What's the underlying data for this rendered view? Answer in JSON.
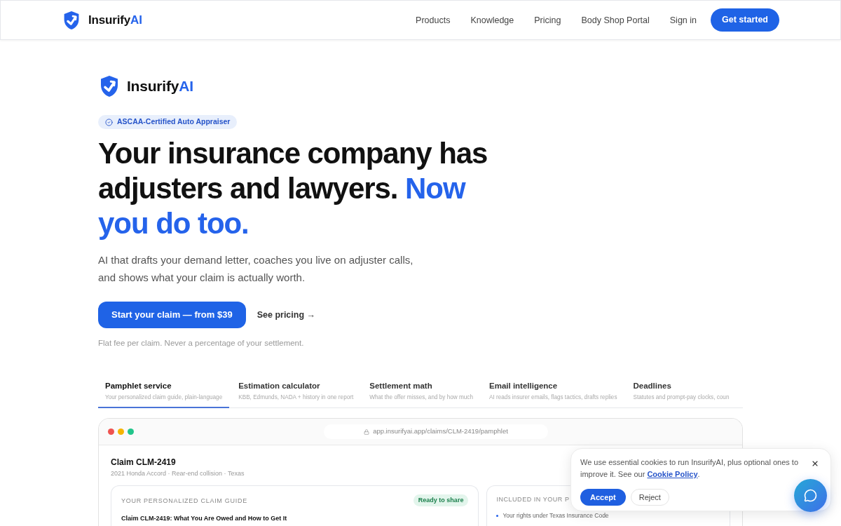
{
  "nav": {
    "brand": {
      "name": "Insurify",
      "accent": "AI"
    },
    "links": [
      "Products",
      "Knowledge",
      "Pricing",
      "Body Shop Portal",
      "Sign in"
    ],
    "cta": "Get started"
  },
  "hero": {
    "brand": {
      "name": "Insurify",
      "accent": "AI"
    },
    "badge": "ASCAA-Certified Auto Appraiser",
    "headline": {
      "text": "Your insurance company has adjusters and lawyers.",
      "highlight": "Now you do too."
    },
    "subtitle": "AI that drafts your demand letter, coaches you live on adjuster calls, and shows what your claim is actually worth.",
    "primary_button": "Start your claim — from $39",
    "secondary_link": "See pricing →",
    "note": "Flat fee per claim. Never a percentage of your settlement."
  },
  "feature_tabs": [
    {
      "title": "Pamphlet service",
      "subtitle": "Your personalized claim guide, plain-language",
      "selected": true
    },
    {
      "title": "Estimation calculator",
      "subtitle": "KBB, Edmunds, NADA + history in one report",
      "selected": false
    },
    {
      "title": "Settlement math",
      "subtitle": "What the offer misses, and by how much",
      "selected": false
    },
    {
      "title": "Email intelligence",
      "subtitle": "AI reads insurer emails, flags tactics, drafts replies",
      "selected": false
    },
    {
      "title": "Deadlines",
      "subtitle": "Statutes and prompt-pay clocks, coun",
      "selected": false
    }
  ],
  "preview": {
    "url": "app.insurifyai.app/claims/CLM-2419/pamphlet",
    "claim": {
      "title": "Claim CLM-2419",
      "meta": "2021 Honda Accord · Rear-end collision · Texas"
    },
    "guide_card": {
      "heading": "YOUR PERSONALIZED CLAIM GUIDE",
      "status": "Ready to share",
      "title": "Claim CLM-2419: What You Are Owed and How to Get It"
    },
    "included_card": {
      "heading": "INCLUDED IN YOUR P",
      "items": [
        "Your rights under Texas Insurance Code"
      ]
    }
  },
  "cookie_banner": {
    "text": "We use essential cookies to run InsurifyAI, plus optional ones to improve it. See our",
    "link": "Cookie Policy",
    "text_after": ".",
    "buttons": [
      {
        "label": "Accept",
        "kind": "primary"
      },
      {
        "label": "Reject",
        "kind": "secondary"
      }
    ]
  }
}
